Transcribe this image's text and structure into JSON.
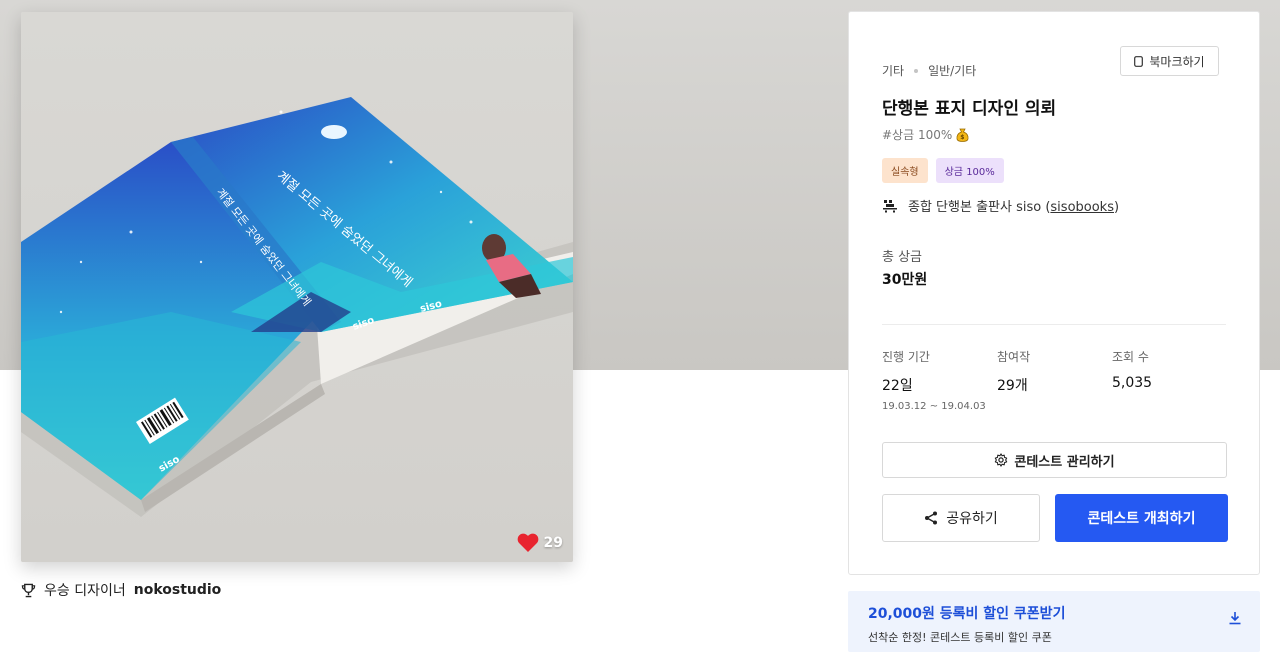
{
  "image": {
    "like_count": "29",
    "book": {
      "brand": "siso",
      "spine_text": "siso"
    }
  },
  "winner": {
    "prefix": "우승 디자이너",
    "name": "nokostudio"
  },
  "contest": {
    "category": "기타",
    "subcategory": "일반/기타",
    "bookmark_label": "북마크하기",
    "title": "단행본 표지 디자인 의뢰",
    "hashtag": "#상금 100%",
    "tags": [
      "실속형",
      "상금 100%"
    ],
    "host_text": "종합 단행본 출판사 siso (",
    "host_handle": "sisobooks",
    "host_close": ")",
    "total_prize_label": "총 상금",
    "total_prize_value": "30만원",
    "stats": [
      {
        "label": "진행 기간",
        "value": "22일",
        "sub": "19.03.12 ~ 19.04.03"
      },
      {
        "label": "참여작",
        "value": "29개"
      },
      {
        "label": "조회 수",
        "value": "5,035"
      }
    ],
    "manage_label": "콘테스트 관리하기",
    "share_label": "공유하기",
    "host_contest_label": "콘테스트 개최하기"
  },
  "coupon": {
    "title": "20,000원 등록비 할인 쿠폰받기",
    "subtitle": "선착순 한정! 콘테스트 등록비 할인 쿠폰"
  },
  "colors": {
    "primary": "#2559f2",
    "coupon_bg": "#eef3fd",
    "heart": "#e8242f"
  },
  "icons": [
    "heart-icon",
    "trophy-icon",
    "bookmark-icon",
    "coin-bag-icon",
    "host-logo-icon",
    "gear-icon",
    "share-icon",
    "download-icon"
  ]
}
